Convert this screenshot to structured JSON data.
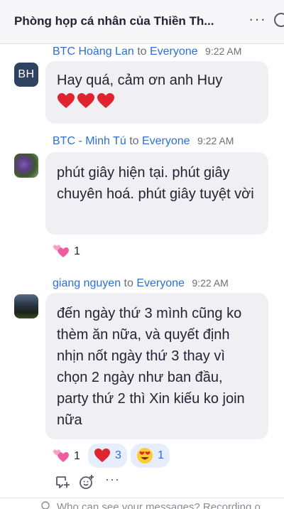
{
  "header": {
    "title": "Phòng họp cá nhân của Thiền Th...",
    "more_label": "···"
  },
  "messages": [
    {
      "avatar_initials": "BH",
      "sender": "BTC Hoàng Lan",
      "to_label": "to",
      "recipient": "Everyone",
      "time": "9:22 AM",
      "text": "Hay quá, cảm ơn anh Huy",
      "hearts": [
        "❤",
        "❤",
        "❤"
      ]
    },
    {
      "sender": "BTC - Minh Tú",
      "to_label": "to",
      "recipient": "Everyone",
      "time": "9:22 AM",
      "text": "phút giây hiện tại. phút giây chuyên hoá. phút giây tuyệt vời",
      "reactions": [
        {
          "icon": "two-hearts-icon",
          "count": "1"
        }
      ]
    },
    {
      "sender": "giang nguyen",
      "to_label": "to",
      "recipient": "Everyone",
      "time": "9:22 AM",
      "text": "đến ngày thứ 3 mình cũng ko thèm ăn nữa, và quyết định nhịn nốt ngày thứ 3 thay vì chọn 2 ngày như ban đầu, party thứ 2 thì Xin kiếu ko join nữa",
      "reactions": [
        {
          "icon": "two-hearts-icon",
          "count": "1"
        },
        {
          "icon": "red-heart-icon",
          "count": "3"
        },
        {
          "icon": "heart-eyes-emoji-icon",
          "count": "1"
        }
      ]
    }
  ],
  "actions": {
    "more_label": "···"
  },
  "footer": {
    "privacy_text": "Who can see your messages? Recording o..."
  },
  "colors": {
    "link_blue": "#2d6fd6",
    "bubble_bg": "#f0f0f4",
    "heart_red": "#e0242f"
  }
}
